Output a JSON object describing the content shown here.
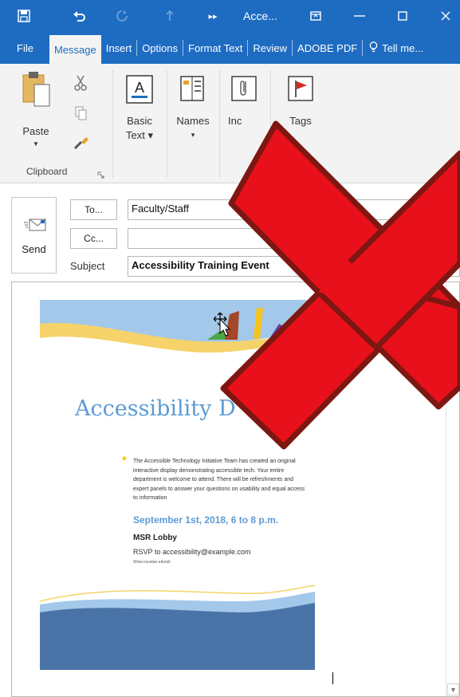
{
  "window": {
    "title": "Acce...",
    "icons": [
      "save-icon",
      "undo-icon",
      "redo-icon",
      "up-arrow-icon",
      "more-commands-icon",
      "restore-ribbon-icon",
      "minimize-icon",
      "maximize-icon",
      "close-icon"
    ]
  },
  "tabs": [
    {
      "label": "File"
    },
    {
      "label": "Message",
      "active": true
    },
    {
      "label": "Insert"
    },
    {
      "label": "Options"
    },
    {
      "label": "Format Text"
    },
    {
      "label": "Review"
    },
    {
      "label": "ADOBE PDF"
    },
    {
      "label": "Tell me..."
    }
  ],
  "ribbon": {
    "paste": "Paste",
    "basic_text_1": "Basic",
    "basic_text_2": "Text",
    "names": "Names",
    "include": "Inc",
    "tags": "Tags",
    "clipboard_group": "Clipboard"
  },
  "message": {
    "send": "Send",
    "to_button": "To...",
    "cc_button": "Cc...",
    "to_value": "Faculty/Staff",
    "cc_value": "",
    "subject_label": "Subject",
    "subject_value": "Accessibility Training Event"
  },
  "flyer": {
    "title": "Accessibility D",
    "asterisk": "*",
    "paragraph": "The Accessible Technology Initiative Team has created an original interactive display demonstrating accessible tech. Your entire department is welcome to attend. There will be refreshments and expert panels to answer your questions on usability and equal access to information",
    "date": "September 1st, 2018, 6 to 8 p.m.",
    "location": "MSR Lobby",
    "rsvp": "RSVP to accessibility@example.com",
    "url": "Www.csustan.edu/ati"
  },
  "colors": {
    "titlebar": "#1e6cc2",
    "ribbon": "#f3f3f3",
    "flyer_blue": "#5b9bd5",
    "flyer_yellow": "#f5d36a",
    "x_red": "#e8101a",
    "x_outline": "#7d1712"
  }
}
